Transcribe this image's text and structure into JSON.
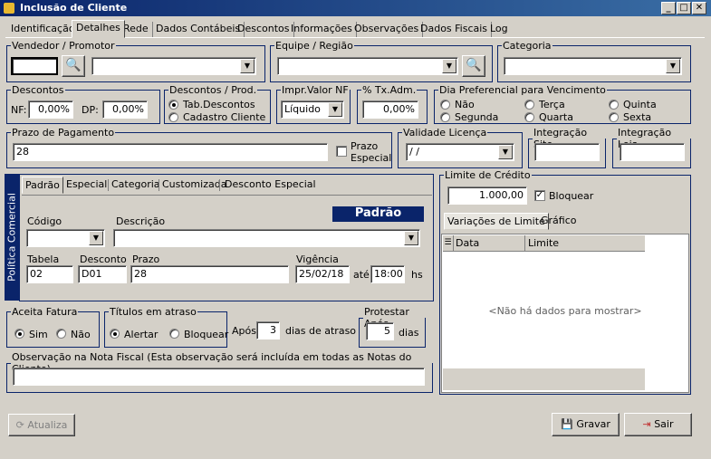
{
  "window": {
    "title": "Inclusão de Cliente",
    "min": "_",
    "max": "□",
    "close": "✕"
  },
  "tabs": [
    "Identificação",
    "Detalhes",
    "Rede",
    "Dados Contábeis",
    "Descontos",
    "Informações",
    "Observações",
    "Dados Fiscais",
    "Log"
  ],
  "active_tab": "Detalhes",
  "vendedor": {
    "legend": "Vendedor / Promotor",
    "code": "",
    "name": ""
  },
  "equipe": {
    "legend": "Equipe / Região",
    "value": ""
  },
  "categoria": {
    "legend": "Categoria",
    "value": ""
  },
  "descontos": {
    "legend": "Descontos",
    "nf_label": "NF:",
    "nf_value": "0,00%",
    "dp_label": "DP:",
    "dp_value": "0,00%"
  },
  "desc_prod": {
    "legend": "Descontos / Prod.",
    "opt1": "Tab.Descontos",
    "opt2": "Cadastro Cliente"
  },
  "impr": {
    "legend": "Impr.Valor NF",
    "value": "Líquido"
  },
  "tx_adm": {
    "legend": "% Tx.Adm.",
    "value": "0,00%"
  },
  "dia_pref": {
    "legend": "Dia Preferencial para Vencimento",
    "opts": [
      "Não",
      "Segunda",
      "Terça",
      "Quarta",
      "Quinta",
      "Sexta"
    ]
  },
  "prazo": {
    "legend": "Prazo de Pagamento",
    "value": "28",
    "check_label_1": "Prazo",
    "check_label_2": "Especial"
  },
  "validade": {
    "legend": "Validade Licença",
    "value": " /  /"
  },
  "integ_site": {
    "legend": "Integração Site"
  },
  "integ_loja": {
    "legend": "Integração Loja"
  },
  "politica": {
    "side_label": "Política Comercial",
    "tabs": [
      "Padrão",
      "Especial",
      "Categoria",
      "Customizada",
      "Desconto Especial"
    ],
    "banner": "Padrão",
    "codigo_label": "Código",
    "descricao_label": "Descrição",
    "tabela_label": "Tabela",
    "tabela": "02",
    "desconto_label": "Desconto",
    "desconto": "D01",
    "prazo_label": "Prazo",
    "prazo": "28",
    "vigencia_label": "Vigência",
    "vigencia": "25/02/18",
    "ate": "até",
    "hora": "18:00",
    "hs": "hs"
  },
  "limite": {
    "legend": "Limite de Crédito",
    "value": "1.000,00",
    "bloquear": "Bloquear",
    "tabs": [
      "Variações de Limite",
      "Gráfico"
    ],
    "columns": [
      "Data",
      "Limite"
    ],
    "empty": "<Não há dados para mostrar>"
  },
  "aceita": {
    "legend": "Aceita Fatura",
    "sim": "Sim",
    "nao": "Não"
  },
  "titulos": {
    "legend": "Títulos em atraso",
    "alertar": "Alertar",
    "bloquear": "Bloquear",
    "apos": "Após",
    "dias": "3",
    "dias_label": "dias de atraso"
  },
  "protestar": {
    "legend": "Protestar Após",
    "value": "5",
    "dias": "dias"
  },
  "obs": {
    "legend": "Observação na Nota Fiscal (Esta observação será incluída em todas as Notas do Cliente)",
    "value": ""
  },
  "buttons": {
    "atualiza": "Atualiza",
    "gravar": "Gravar",
    "sair": "Sair"
  }
}
